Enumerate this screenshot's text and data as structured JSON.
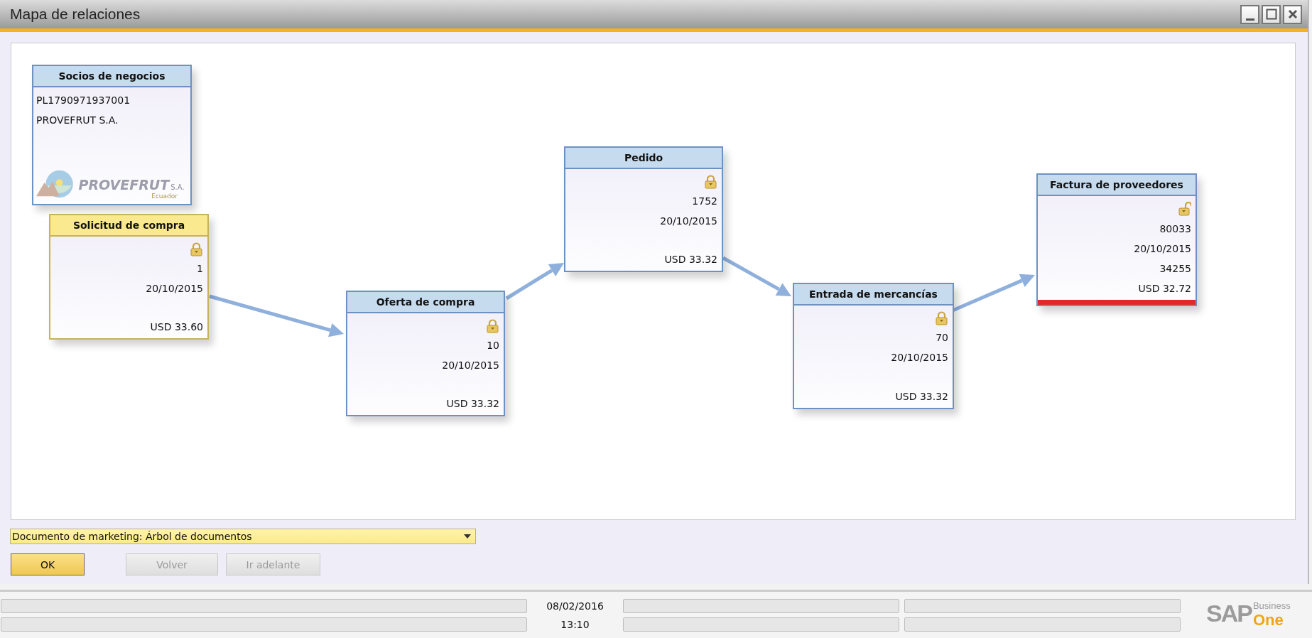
{
  "window": {
    "title": "Mapa de relaciones"
  },
  "cards": [
    {
      "kind": "partner",
      "title": "Socios de negocios",
      "lines": [
        "PL1790971937001",
        "PROVEFRUT S.A."
      ],
      "logo": {
        "name": "PROVEFRUT",
        "suffix": "S.A.",
        "country": "Ecuador"
      }
    },
    {
      "kind": "document",
      "title": "Solicitud de compra",
      "selected": true,
      "locked": true,
      "number": "1",
      "date": "20/10/2015",
      "amount": "USD 33.60"
    },
    {
      "kind": "document",
      "title": "Oferta de compra",
      "selected": false,
      "locked": true,
      "number": "10",
      "date": "20/10/2015",
      "amount": "USD 33.32"
    },
    {
      "kind": "document",
      "title": "Pedido",
      "selected": false,
      "locked": true,
      "number": "1752",
      "date": "20/10/2015",
      "amount": "USD 33.32"
    },
    {
      "kind": "document",
      "title": "Entrada de mercancías",
      "selected": false,
      "locked": true,
      "number": "70",
      "date": "20/10/2015",
      "amount": "USD 33.32"
    },
    {
      "kind": "document",
      "title": "Factura de proveedores",
      "selected": false,
      "locked": false,
      "number": "80033",
      "date": "20/10/2015",
      "reference": "34255",
      "amount": "USD 32.72",
      "flagged": true
    }
  ],
  "view_selector": {
    "value": "Documento de marketing: Árbol de documentos"
  },
  "buttons": [
    {
      "label": "OK",
      "disabled": false
    },
    {
      "label": "Volver",
      "disabled": true
    },
    {
      "label": "Ir adelante",
      "disabled": true
    }
  ],
  "status_bar": {
    "date": "08/02/2016",
    "time": "13:10",
    "logo": {
      "brand": "SAP",
      "line1": "Business",
      "line2": "One"
    }
  }
}
